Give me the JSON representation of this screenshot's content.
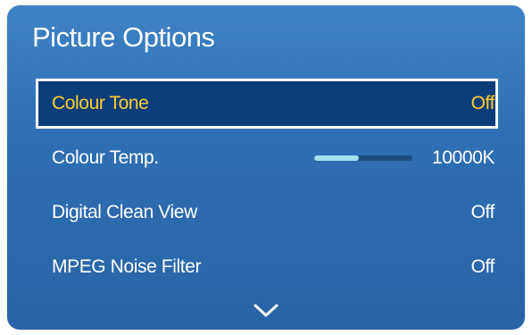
{
  "window": {
    "title": "Picture Options"
  },
  "menu": {
    "items": [
      {
        "label": "Colour Tone",
        "value": "Off",
        "selected": true
      },
      {
        "label": "Colour Temp.",
        "value": "10000K",
        "selected": false,
        "level": 0.45
      },
      {
        "label": "Digital Clean View",
        "value": "Off",
        "selected": false
      },
      {
        "label": "MPEG Noise Filter",
        "value": "Off",
        "selected": false
      }
    ]
  },
  "icons": {
    "scroll_down": "chevron-down-icon"
  },
  "colors": {
    "panel_background": "#2f6fb4",
    "selected_background": "#0b3d7a",
    "selected_text": "#ffcf2a",
    "text": "#ffffff",
    "slider_fill": "#a4e2ee",
    "slider_track": "#1e4c80"
  }
}
